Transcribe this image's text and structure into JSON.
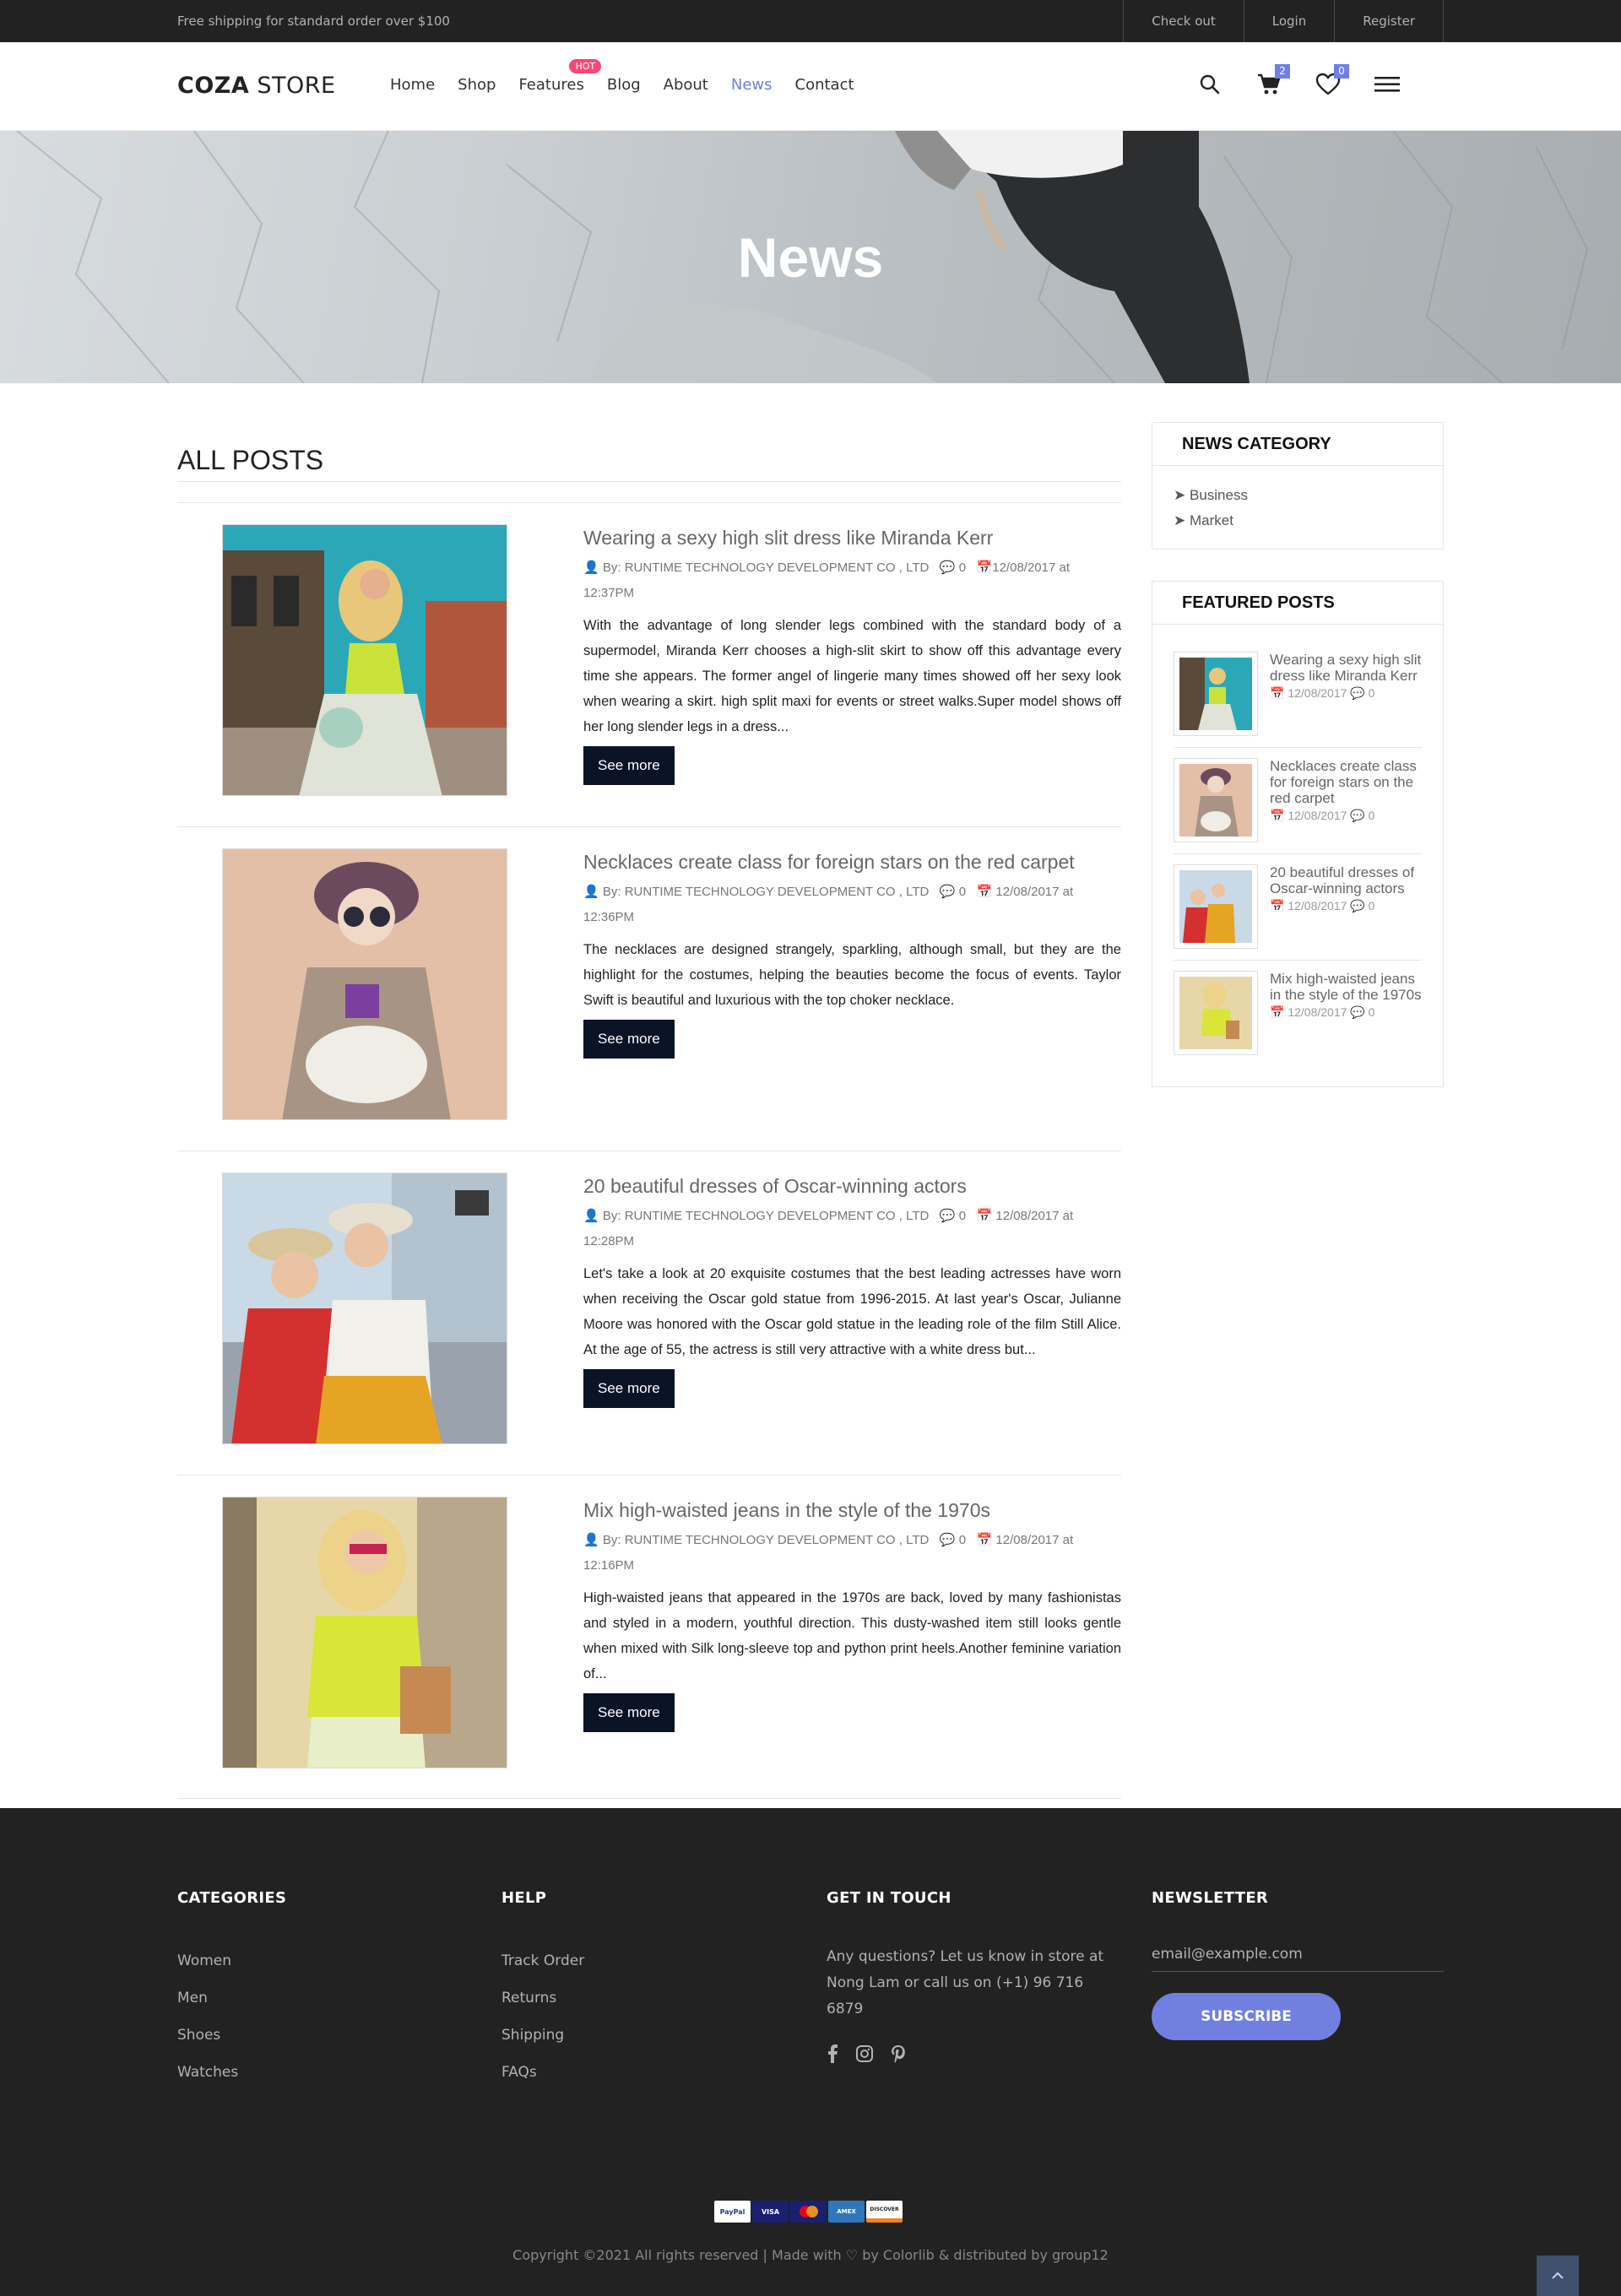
{
  "topbar": {
    "promo": "Free shipping for standard order over $100",
    "links": [
      "Check out",
      "Login",
      "Register"
    ]
  },
  "header": {
    "logo_bold": "COZA",
    "logo_rest": " STORE",
    "nav": [
      {
        "label": "Home"
      },
      {
        "label": "Shop"
      },
      {
        "label": "Features",
        "badge": "HOT"
      },
      {
        "label": "Blog"
      },
      {
        "label": "About"
      },
      {
        "label": "News",
        "active": true
      },
      {
        "label": "Contact"
      }
    ],
    "cart_count": "2",
    "wishlist_count": "0",
    "accent_color": "#717fe0"
  },
  "banner": {
    "title": "News"
  },
  "main": {
    "title": "ALL POSTS",
    "see_more": "See more",
    "posts": [
      {
        "title": "Wearing a sexy high slit dress like Miranda Kerr",
        "author": "By: RUNTIME TECHNOLOGY DEVELOPMENT CO , LTD",
        "comments": "0",
        "date": "12/08/2017 at 12:37PM",
        "excerpt": "With the advantage of long slender legs combined with the standard body of a supermodel, Miranda Kerr chooses a high-slit skirt to show off this advantage every time she appears. The former angel of lingerie many times showed off her sexy look when wearing a skirt. high split maxi for events or street walks.Super model shows off her long slender legs in a dress..."
      },
      {
        "title": "Necklaces create class for foreign stars on the red carpet",
        "author": "By: RUNTIME TECHNOLOGY DEVELOPMENT CO , LTD",
        "comments": "0",
        "date": "12/08/2017 at 12:36PM",
        "excerpt": "The necklaces are designed strangely, sparkling, although small, but they are the highlight for the costumes, helping the beauties become the focus of events. Taylor Swift is beautiful and luxurious with the top choker necklace."
      },
      {
        "title": "20 beautiful dresses of Oscar-winning actors",
        "author": "By: RUNTIME TECHNOLOGY DEVELOPMENT CO , LTD",
        "comments": "0",
        "date": "12/08/2017 at 12:28PM",
        "excerpt": "Let's take a look at 20 exquisite costumes that the best leading actresses have worn when receiving the Oscar gold statue from 1996-2015. At last year's Oscar, Julianne Moore was honored with the Oscar gold statue in the leading role of the film  Still Alice. At the age of 55, the actress is still very attractive with a white dress but..."
      },
      {
        "title": "Mix high-waisted jeans in the style of the 1970s",
        "author": "By: RUNTIME TECHNOLOGY DEVELOPMENT CO , LTD",
        "comments": "0",
        "date": "12/08/2017 at 12:16PM",
        "excerpt": "High-waisted jeans that appeared in the 1970s are back, loved by many fashionistas and styled in a modern, youthful direction. This dusty-washed item still looks gentle when mixed with Silk long-sleeve top and python print heels.Another feminine variation of..."
      }
    ]
  },
  "sidebar": {
    "category_title": "NEWS CATEGORY",
    "categories": [
      "Business",
      "Market"
    ],
    "featured_title": "FEATURED POSTS",
    "featured": [
      {
        "title": "Wearing a sexy high slit dress like Miranda Kerr",
        "date": "12/08/2017",
        "comments": "0"
      },
      {
        "title": "Necklaces create class for foreign stars on the red carpet",
        "date": "12/08/2017",
        "comments": "0"
      },
      {
        "title": "20 beautiful dresses of Oscar-winning actors",
        "date": "12/08/2017",
        "comments": "0"
      },
      {
        "title": "Mix high-waisted jeans in the style of the 1970s",
        "date": "12/08/2017",
        "comments": "0"
      }
    ]
  },
  "footer": {
    "categories_title": "CATEGORIES",
    "categories": [
      "Women",
      "Men",
      "Shoes",
      "Watches"
    ],
    "help_title": "HELP",
    "help": [
      "Track Order",
      "Returns",
      "Shipping",
      "FAQs"
    ],
    "touch_title": "GET IN TOUCH",
    "touch_text": "Any questions? Let us know in store at Nong Lam or call us on (+1) 96 716 6879",
    "newsletter_title": "NEWSLETTER",
    "newsletter_placeholder": "email@example.com",
    "subscribe": "SUBSCRIBE",
    "payments": [
      "PayPal",
      "VISA",
      "MasterCard",
      "AMEX",
      "DISCOVER"
    ],
    "copy_prefix": "Copyright ©2021 All rights reserved | Made with",
    "copy_by": "by",
    "copy_colorlib": "Colorlib",
    "copy_dist": "& distributed by",
    "copy_group": "group12"
  }
}
